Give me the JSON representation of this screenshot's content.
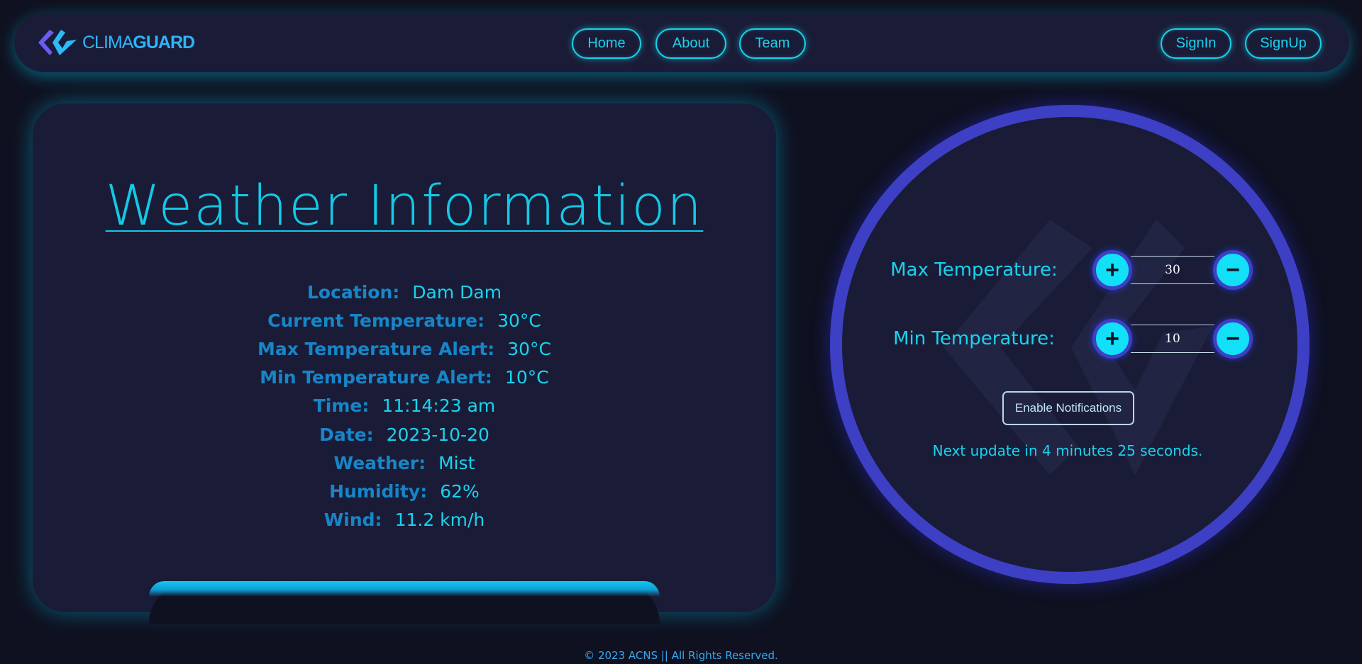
{
  "brand": {
    "light": "CLIMA",
    "bold": "GUARD"
  },
  "nav": {
    "home": "Home",
    "about": "About",
    "team": "Team",
    "signin": "SignIn",
    "signup": "SignUp"
  },
  "weather": {
    "title": "Weather Information",
    "rows": [
      {
        "label": "Location:",
        "value": "Dam Dam"
      },
      {
        "label": "Current Temperature:",
        "value": "30°C"
      },
      {
        "label": "Max Temperature Alert:",
        "value": "30°C"
      },
      {
        "label": "Min Temperature Alert:",
        "value": "10°C"
      },
      {
        "label": "Time:",
        "value": "11:14:23 am"
      },
      {
        "label": "Date:",
        "value": "2023-10-20"
      },
      {
        "label": "Weather:",
        "value": "Mist"
      },
      {
        "label": "Humidity:",
        "value": "62%"
      },
      {
        "label": "Wind:",
        "value": "11.2 km/h"
      }
    ]
  },
  "controls": {
    "max": {
      "label": "Max Temperature:",
      "value": "30",
      "plus": "+",
      "minus": "−"
    },
    "min": {
      "label": "Min Temperature:",
      "value": "10",
      "plus": "+",
      "minus": "−"
    },
    "notify_label": "Enable Notifications",
    "update_text": "Next update in 4 minutes 25 seconds."
  },
  "footer": {
    "text": "© 2023 ACNS || All Rights Reserved."
  },
  "colors": {
    "background": "#0f1120",
    "panel": "#1a1c37",
    "accent": "#19d3ee",
    "label": "#1686c8",
    "ring": "#3d40c4"
  },
  "icons": {
    "logo": "climaguard-logo-icon",
    "plus": "plus-icon",
    "minus": "minus-icon"
  }
}
